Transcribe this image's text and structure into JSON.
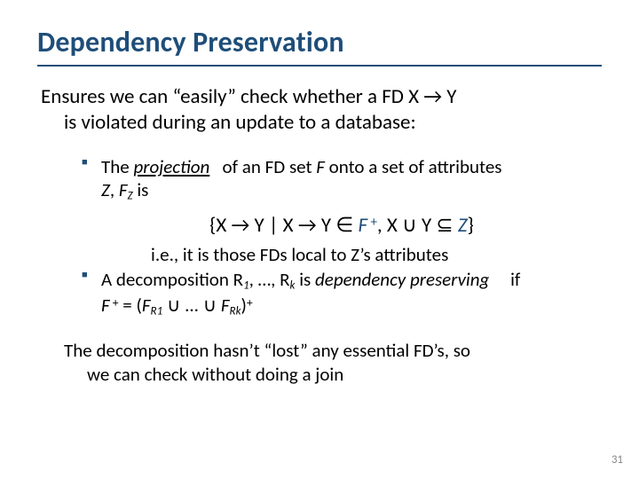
{
  "title": "Dependency Preservation",
  "lead_line1": "Ensures we can “easily” check whether a FD X → Y",
  "lead_line2": "is violated during an update to a database:",
  "bullet1_pre": "The ",
  "bullet1_em": "projection",
  "bullet1_post_a": " of an FD set ",
  "bullet1_F": "F",
  "bullet1_post_b": " onto a set of attributes ",
  "bullet1_line2_a": "Z",
  "bullet1_line2_b": ", ",
  "bullet1_line2_c": "F",
  "bullet1_line2_sub": "Z",
  "bullet1_line2_d": " is",
  "formula_open": "{X → Y | X → Y ∈ ",
  "formula_F": "F",
  "formula_plus1": " +",
  "formula_mid": ", X ∪ Y ⊆ ",
  "formula_Z": "Z",
  "formula_close": "}",
  "subnote": "i.e., it is those FDs local to Z’s attributes",
  "bullet2_a": "A decomposition R",
  "bullet2_sub1": "1",
  "bullet2_b": ", …, R",
  "bullet2_subk": "k",
  "bullet2_c": " is ",
  "bullet2_em": "dependency preserving",
  "bullet2_if": " if",
  "bullet2_line2_a": "F",
  "bullet2_line2_plus": " +",
  "bullet2_line2_eq": " = (",
  "bullet2_line2_F1": "F",
  "bullet2_line2_R1": "R1",
  "bullet2_line2_dots": " ∪ ... ∪ ",
  "bullet2_line2_Fk": "F",
  "bullet2_line2_Rk": "Rk",
  "bullet2_line2_close": ")",
  "bullet2_line2_plus2": "+",
  "closing_line1": "The decomposition hasn’t “lost” any essential FD’s, so",
  "closing_line2": "we can check without doing a join",
  "pagenum": "31"
}
